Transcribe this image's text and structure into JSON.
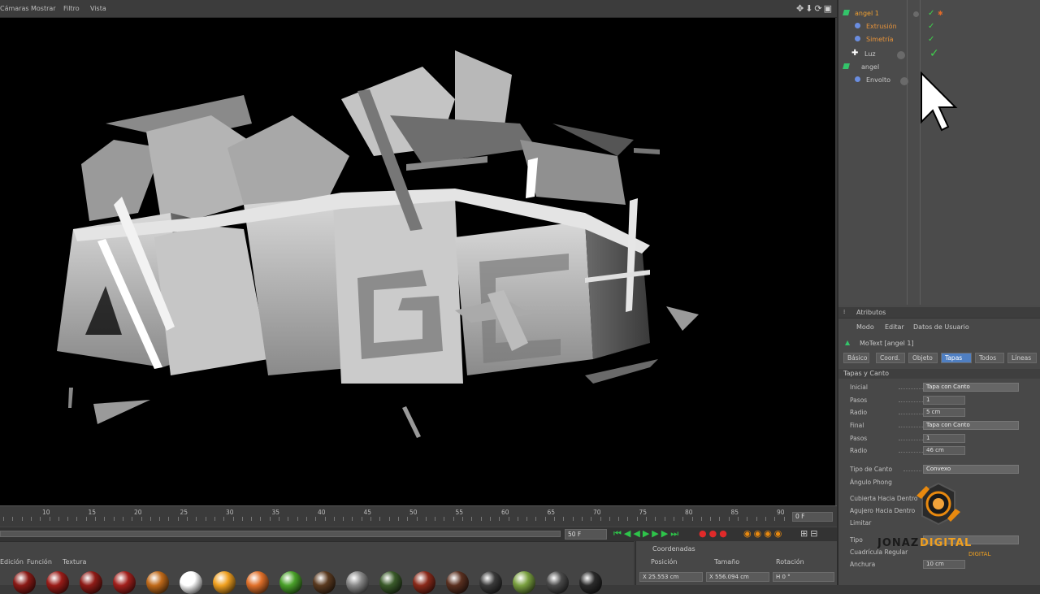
{
  "menu": [
    "Cámaras",
    "Mostrar",
    "Filtro",
    "Vista"
  ],
  "viewport": {
    "text3d": "ANGEL"
  },
  "objects": [
    {
      "name": "angel 1",
      "type": "motext",
      "color": "#f0a030",
      "indent": 0
    },
    {
      "name": "Extrusión",
      "type": "effector",
      "color": "#e8943a",
      "indent": 1
    },
    {
      "name": "Simetría",
      "type": "effector",
      "color": "#e8943a",
      "indent": 1
    },
    {
      "name": "Luz",
      "type": "light",
      "color": "#d0d0d0",
      "indent": 0
    },
    {
      "name": "angel",
      "type": "motext",
      "color": "#d0d0d0",
      "indent": 0
    },
    {
      "name": "Envolto",
      "type": "effector",
      "color": "#d0d0d0",
      "indent": 1
    }
  ],
  "attributes": {
    "panel_title": "Atributos",
    "menu": [
      "Modo",
      "Editar",
      "Datos de Usuario"
    ],
    "object_label": "MoText [angel 1]",
    "tabs": [
      "Básico",
      "Coord.",
      "Objeto",
      "Tapas",
      "Todos",
      "Líneas"
    ],
    "active_tab": "Tapas",
    "section": "Tapas y Canto",
    "fields": [
      {
        "label": "Inicial",
        "value": "Tapa con Canto",
        "kind": "dropdown"
      },
      {
        "label": "Pasos",
        "value": "1",
        "kind": "number"
      },
      {
        "label": "Radio",
        "value": "5 cm",
        "kind": "number"
      },
      {
        "label": "Final",
        "value": "Tapa con Canto",
        "kind": "dropdown"
      },
      {
        "label": "Pasos",
        "value": "1",
        "kind": "number"
      },
      {
        "label": "Radio",
        "value": "46 cm",
        "kind": "number"
      },
      {
        "label": "Tipo de Canto",
        "value": "Convexo",
        "kind": "dropdown"
      },
      {
        "label": "Ángulo Phong",
        "value": "",
        "kind": "check"
      },
      {
        "label": "Cubierta Hacia Dentro",
        "value": "",
        "kind": "check"
      },
      {
        "label": "Agujero Hacia Dentro",
        "value": "",
        "kind": "check"
      },
      {
        "label": "Limitar",
        "value": "",
        "kind": "check"
      },
      {
        "label": "Tipo",
        "value": "",
        "kind": "dropdown"
      },
      {
        "label": "Cuadrícula Regular",
        "value": "",
        "kind": "check"
      },
      {
        "label": "Anchura",
        "value": "10 cm",
        "kind": "number"
      }
    ]
  },
  "logo": {
    "brand": "JONAZ DIGITAL",
    "sub": "DIGITAL"
  },
  "timeline": {
    "ticks": [
      "10",
      "15",
      "20",
      "25",
      "30",
      "35",
      "40",
      "45",
      "50",
      "55",
      "60",
      "65",
      "70",
      "75",
      "80",
      "85",
      "90"
    ],
    "current_frame": "0 F",
    "end_frame": "50 F"
  },
  "materials": {
    "menu": [
      "Edición",
      "Función",
      "Textura"
    ],
    "colors": [
      "#8a1a16",
      "#9a1c18",
      "#8f1b17",
      "#a2201c",
      "#c06a1a",
      "#ffffff",
      "#f0a020",
      "#e0702a",
      "#4aa02a",
      "#5a3a20",
      "#888888",
      "#3a5a2a",
      "#8a2a1a",
      "#5a3020",
      "#3a3a3a",
      "#7aa040",
      "#4a4a4a",
      "#2a2a2a"
    ]
  },
  "coords": {
    "title": "Coordenadas",
    "headers": [
      "Posición",
      "Tamaño",
      "Rotación"
    ],
    "values": [
      "X  25.553 cm",
      "X  556.094 cm",
      "H  0 °"
    ]
  }
}
